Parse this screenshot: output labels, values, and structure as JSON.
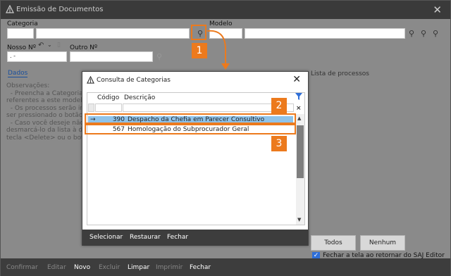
{
  "window": {
    "title": "Emissão de Documentos"
  },
  "form": {
    "categoria_label": "Categoria",
    "modelo_label": "Modelo",
    "nosso_label": "Nosso Nº",
    "outro_label": "Outro Nº",
    "nosso_value": "  .  -"
  },
  "tabs": {
    "dados": "Dados"
  },
  "observacoes": "Observações:\n  - Preencha a Categoria\nreferentes a este modelo\n  - Os processos serão in\nser pressionado o botão\n  - Caso você deseje não\ndesmarcá-lo da lista à d\ntecla <Delete> ou o bot",
  "right_panel": {
    "title": "Lista de processos",
    "todos": "Todos",
    "nenhum": "Nenhum",
    "fechar_checkbox": "Fechar a tela ao retornar do SAJ Editor",
    "fechar_checked": true
  },
  "footer": {
    "confirmar": "Confirmar",
    "editar": "Editar",
    "novo": "Novo",
    "excluir": "Excluir",
    "limpar": "Limpar",
    "imprimir": "Imprimir",
    "fechar": "Fechar"
  },
  "dialog": {
    "title": "Consulta de Categorias",
    "columns": {
      "codigo": "Código",
      "descricao": "Descrição"
    },
    "rows": [
      {
        "marker": "→",
        "codigo": "390",
        "descricao": "Despacho da Chefia em Parecer Consultivo",
        "selected": true
      },
      {
        "marker": "",
        "codigo": "567",
        "descricao": "Homologação do Subprocurador Geral",
        "selected": false
      }
    ],
    "footer": {
      "selecionar": "Selecionar",
      "restaurar": "Restaurar",
      "fechar": "Fechar"
    }
  },
  "annotations": {
    "badge1": "1",
    "badge2": "2",
    "badge3": "3",
    "color": "#ec7a1d"
  }
}
